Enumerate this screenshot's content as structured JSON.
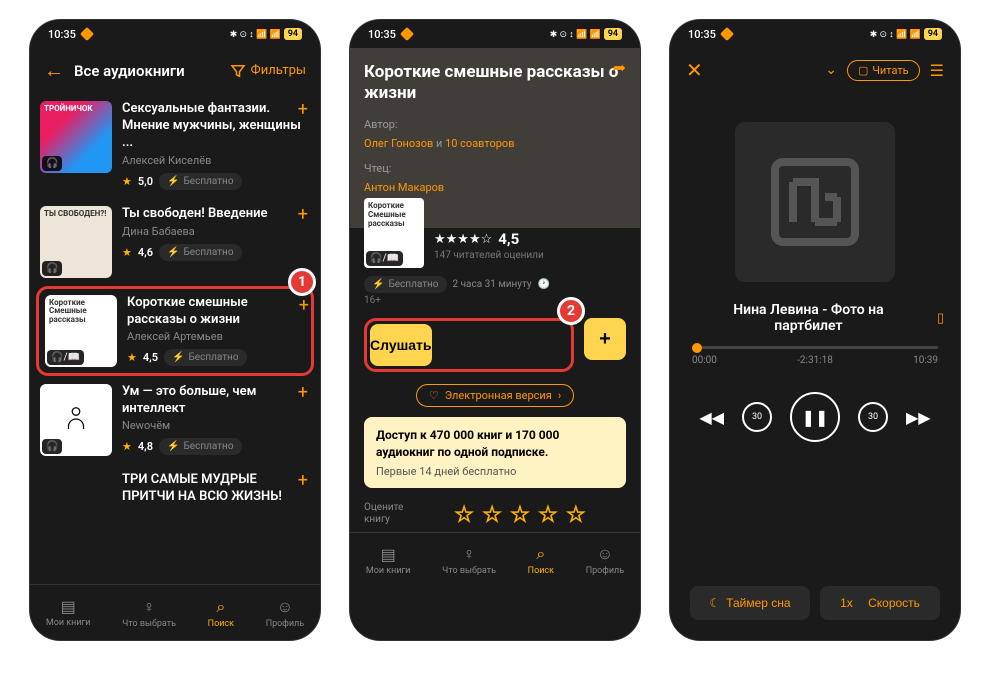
{
  "status": {
    "time": "10:35",
    "battery": "94"
  },
  "s1": {
    "header": {
      "title": "Все аудиокниги",
      "filter": "Фильтры"
    },
    "free": "Бесплатно",
    "books": [
      {
        "title": "Сексуальные фантазии. Мнение мужчины, женщины ...",
        "author": "Алексей Киселёв",
        "rating": "5,0"
      },
      {
        "title": "Ты свободен! Введение",
        "author": "Дина Бабаева",
        "rating": "4,6"
      },
      {
        "title": "Короткие смешные рассказы о жизни",
        "author": "Алексей Артемьев",
        "rating": "4,5"
      },
      {
        "title": "Ум — это больше, чем интеллект",
        "author": "Newочём",
        "rating": "4,8"
      },
      {
        "title": "ТРИ САМЫЕ МУДРЫЕ ПРИТЧИ НА ВСЮ ЖИЗНЬ!",
        "author": "",
        "rating": ""
      }
    ],
    "cover_labels": {
      "c1": "ТРОЙНИЧОК",
      "c2": "ТЫ СВОБОДЕН?!",
      "c3": "Короткие Смешные рассказы"
    },
    "nav": {
      "books": "Мои книги",
      "what": "Что выбрать",
      "search": "Поиск",
      "profile": "Профиль"
    }
  },
  "s2": {
    "title": "Короткие смешные рассказы о жизни",
    "author_label": "Автор:",
    "author": "Олег Гонозов",
    "and": " и ",
    "coauthors": "10 соавторов",
    "reader_label": "Чтец:",
    "reader": "Антон Макаров",
    "rating": "4,5",
    "reviews": "147 читателей оценили",
    "duration": "2 часа 31 минуту",
    "age": "16+",
    "free": "Бесплатно",
    "listen": "Слушать",
    "eversion": "Электронная версия",
    "access_title": "Доступ к 470 000 книг и 170 000 аудиокниг по одной подписке.",
    "access_sub": "Первые 14 дней бесплатно",
    "rate_label": "Оцените книгу"
  },
  "s3": {
    "read": "Читать",
    "track": "Нина Левина - Фото на партбилет",
    "time_start": "00:00",
    "time_mid": "-2:31:18",
    "time_end": "10:39",
    "skip_back": "30",
    "skip_fwd": "30",
    "sleep": "Таймер сна",
    "speed": "Скорость",
    "speed_val": "1x"
  },
  "badges": {
    "one": "1",
    "two": "2"
  }
}
